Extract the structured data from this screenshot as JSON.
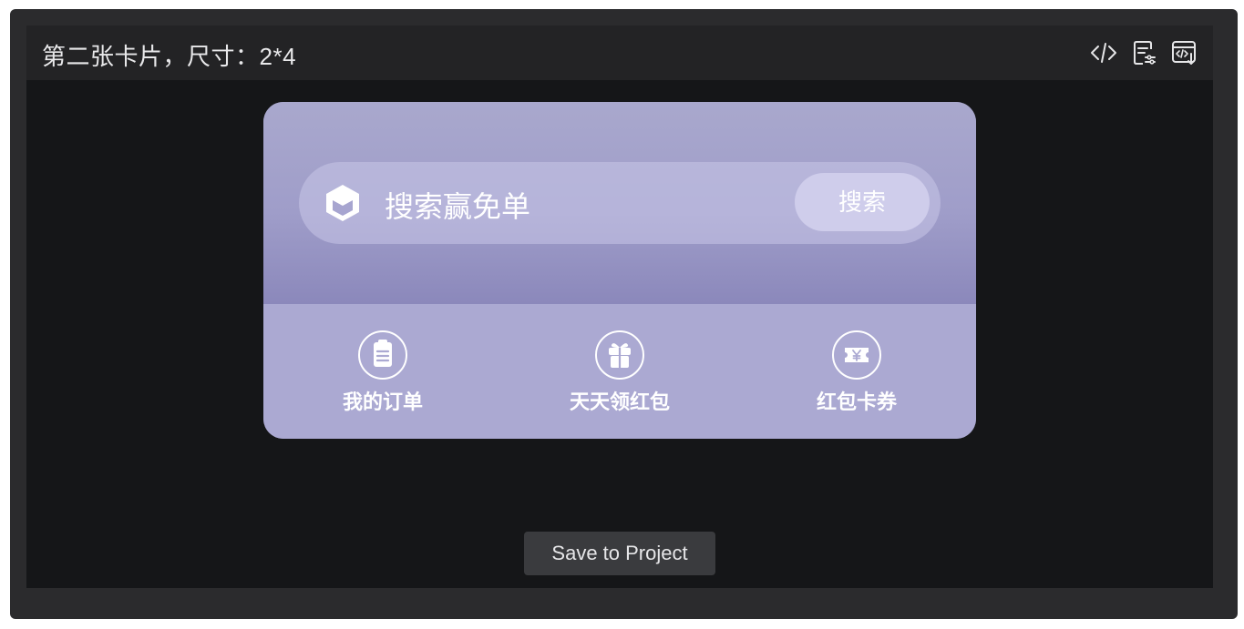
{
  "window": {
    "title": "第二张卡片，尺寸：2*4"
  },
  "toolbar": {
    "icons": [
      "code-icon",
      "config-doc-icon",
      "export-code-icon"
    ]
  },
  "card": {
    "search": {
      "placeholder_text": "搜索赢免单",
      "button_label": "搜索"
    },
    "shortcuts": [
      {
        "label": "我的订单",
        "icon": "clipboard-icon"
      },
      {
        "label": "天天领红包",
        "icon": "gift-icon"
      },
      {
        "label": "红包卡券",
        "icon": "ticket-icon"
      }
    ],
    "colors": {
      "card_bg": "#a9a7d0",
      "search_button_bg": "#cfcdeb"
    }
  },
  "actions": {
    "save_label": "Save to Project"
  }
}
